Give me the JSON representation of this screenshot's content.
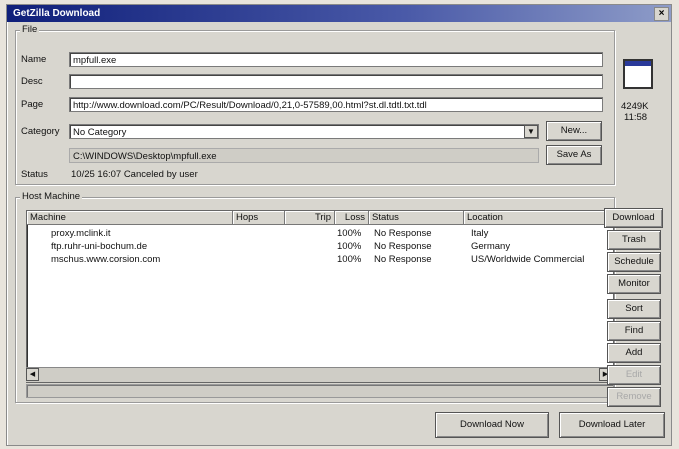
{
  "window": {
    "title": "GetZilla Download",
    "close": "×"
  },
  "file": {
    "group_label": "File",
    "name_label": "Name",
    "name_value": "mpfull.exe",
    "desc_label": "Desc",
    "desc_value": "",
    "page_label": "Page",
    "page_value": "http://www.download.com/PC/Result/Download/0,21,0-57589,00.html?st.dl.tdtl.txt.tdl",
    "category_label": "Category",
    "category_value": "No Category",
    "new_button": "New...",
    "path_value": "C:\\WINDOWS\\Desktop\\mpfull.exe",
    "save_as_button": "Save As",
    "status_label": "Status",
    "status_value": "10/25 16:07 Canceled by user",
    "size": "4249K",
    "time": "11:58"
  },
  "host": {
    "group_label": "Host Machine",
    "columns": [
      "Machine",
      "Hops",
      "Trip",
      "Loss",
      "Status",
      "Location"
    ],
    "rows": [
      {
        "machine": "proxy.mclink.it",
        "hops": "",
        "trip": "",
        "loss": "100%",
        "status": "No Response",
        "location": "Italy"
      },
      {
        "machine": "ftp.ruhr-uni-bochum.de",
        "hops": "",
        "trip": "",
        "loss": "100%",
        "status": "No Response",
        "location": "Germany"
      },
      {
        "machine": "mschus.www.corsion.com",
        "hops": "",
        "trip": "",
        "loss": "100%",
        "status": "No Response",
        "location": "US/Worldwide Commercial"
      }
    ]
  },
  "side_buttons": {
    "download": "Download",
    "trash": "Trash",
    "schedule": "Schedule",
    "monitor": "Monitor",
    "sort": "Sort",
    "find": "Find",
    "add": "Add",
    "edit": "Edit",
    "remove": "Remove"
  },
  "bottom": {
    "download_now": "Download Now",
    "download_later": "Download Later"
  }
}
